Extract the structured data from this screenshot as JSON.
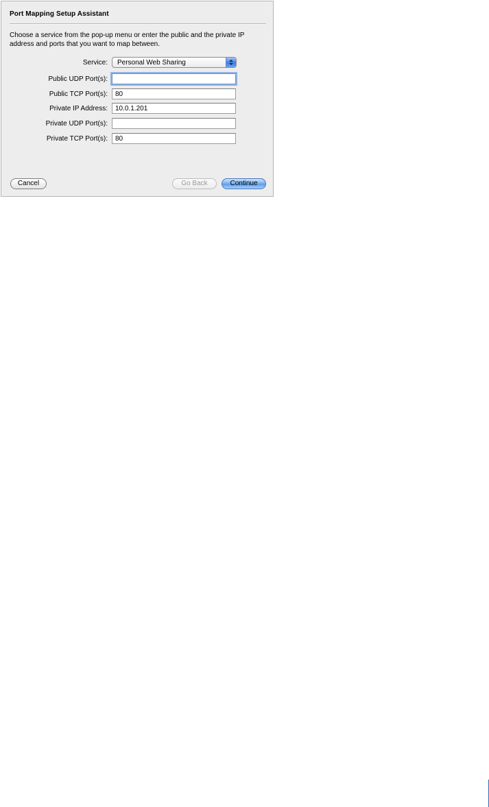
{
  "dialog": {
    "title": "Port Mapping Setup Assistant",
    "instructions": "Choose a service from the pop-up menu or enter the public and the private IP address and ports that you want to map between."
  },
  "form": {
    "service": {
      "label": "Service:",
      "selected": "Personal Web Sharing"
    },
    "public_udp": {
      "label": "Public UDP Port(s):",
      "value": ""
    },
    "public_tcp": {
      "label": "Public TCP Port(s):",
      "value": "80"
    },
    "private_ip": {
      "label": "Private IP Address:",
      "value": "10.0.1.201"
    },
    "private_udp": {
      "label": "Private UDP Port(s):",
      "value": ""
    },
    "private_tcp": {
      "label": "Private TCP Port(s):",
      "value": "80"
    }
  },
  "buttons": {
    "cancel": "Cancel",
    "go_back": "Go Back",
    "continue": "Continue"
  },
  "colors": {
    "accent": "#5a9bea",
    "focus_ring": "#8fb3e6",
    "page_rule": "#2f6db5"
  }
}
